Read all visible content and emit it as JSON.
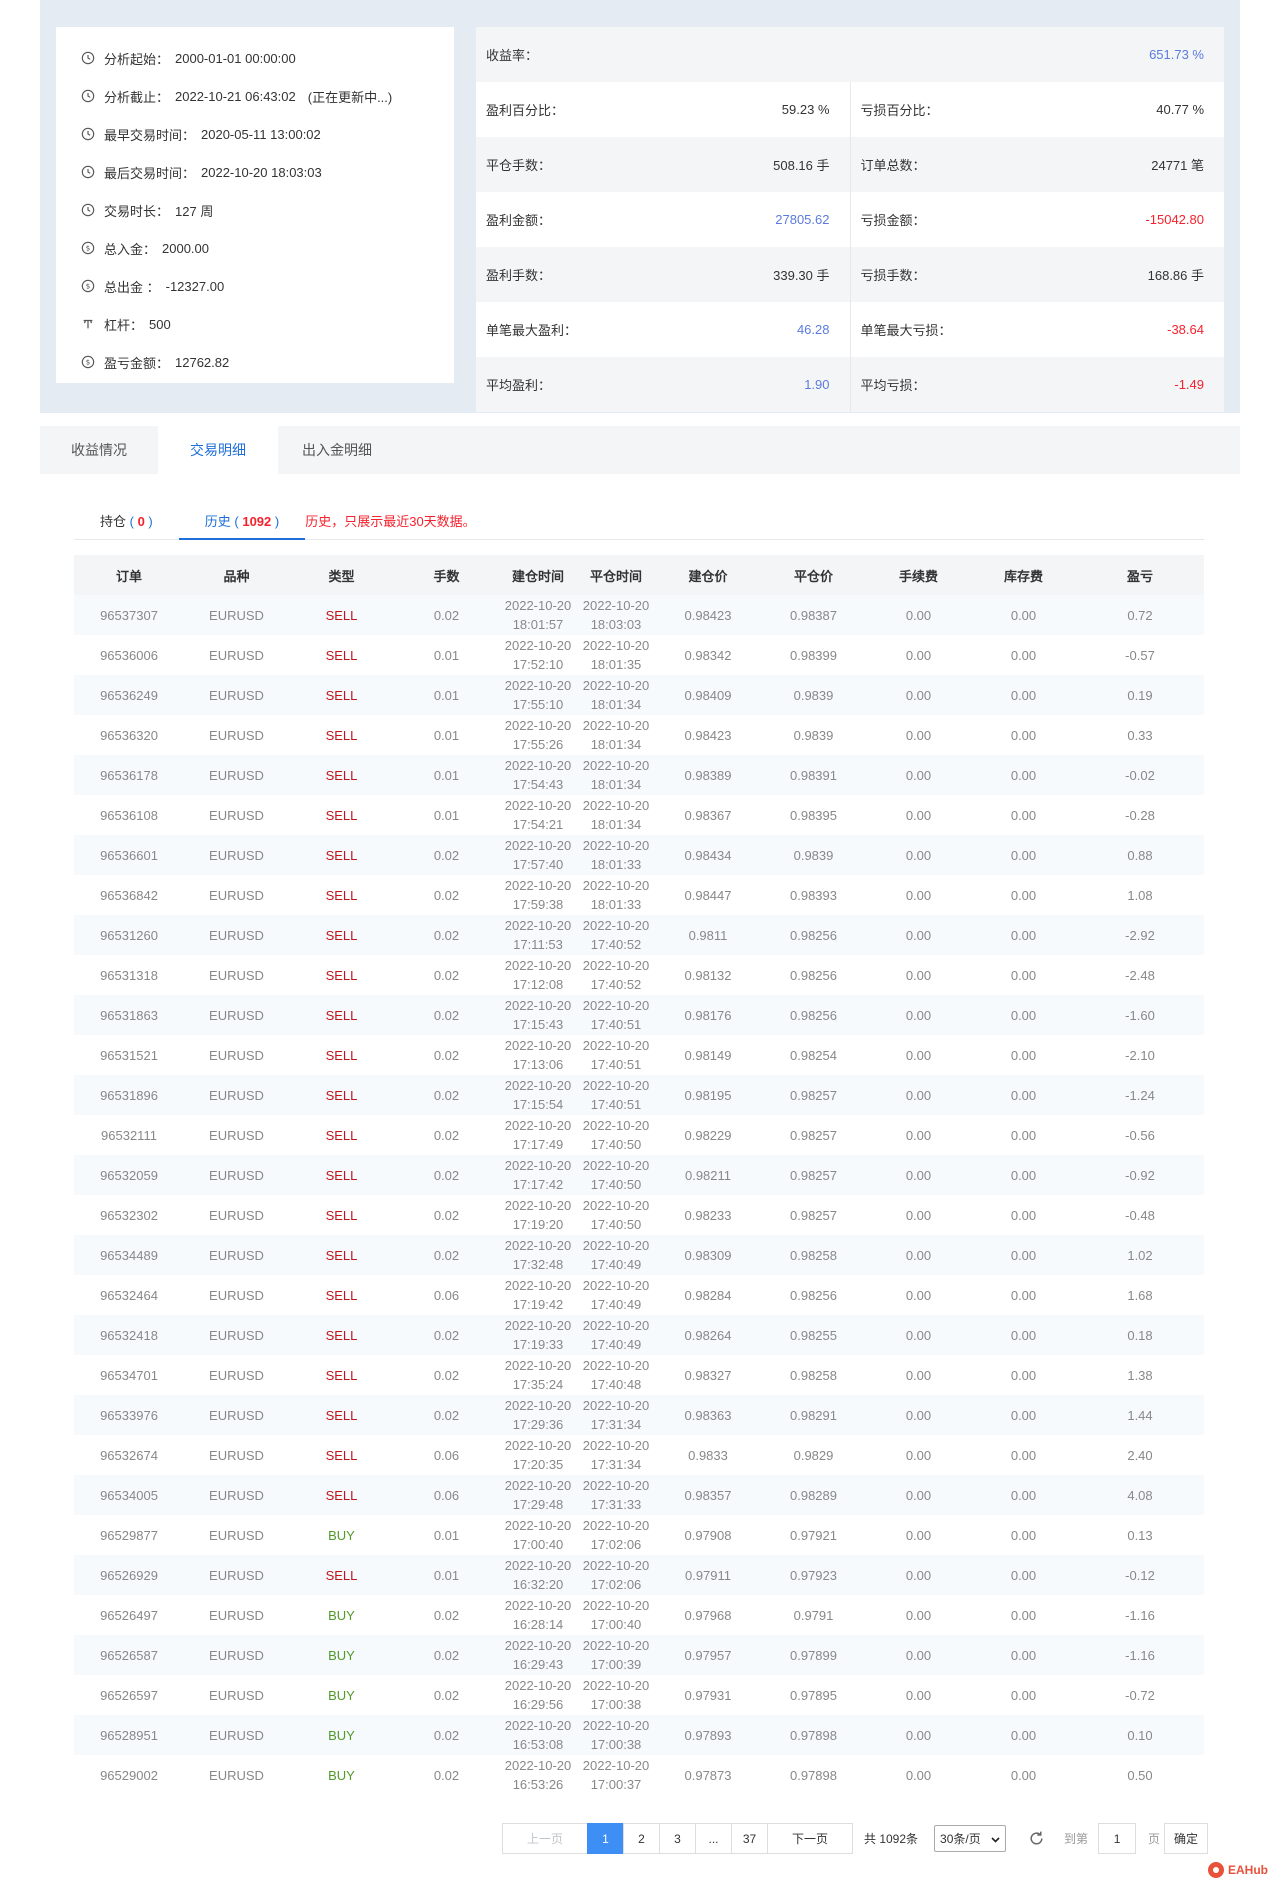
{
  "info": {
    "analysis_start_label": "分析起始：",
    "analysis_start": "2000-01-01 00:00:00",
    "analysis_end_label": "分析截止：",
    "analysis_end": "2022-10-21 06:43:02",
    "analysis_end_status": "(正在更新中...)",
    "earliest_trade_label": "最早交易时间：",
    "earliest_trade": "2020-05-11 13:00:02",
    "latest_trade_label": "最后交易时间：",
    "latest_trade": "2022-10-20 18:03:03",
    "duration_label": "交易时长：",
    "duration": "127 周",
    "deposit_label": "总入金：",
    "deposit": "2000.00",
    "withdrawal_label": "总出金 ：",
    "withdrawal": "-12327.00",
    "leverage_label": "杠杆：",
    "leverage": "500",
    "pnl_amount_label": "盈亏金额：",
    "pnl_amount": "12762.82"
  },
  "stats": {
    "return_rate_label": "收益率：",
    "return_rate": "651.73 %",
    "win_pct_label": "盈利百分比：",
    "win_pct": "59.23 %",
    "loss_pct_label": "亏损百分比：",
    "loss_pct": "40.77 %",
    "closed_lots_label": "平仓手数：",
    "closed_lots": "508.16 手",
    "order_total_label": "订单总数：",
    "order_total": "24771 笔",
    "profit_amount_label": "盈利金额：",
    "profit_amount": "27805.62",
    "loss_amount_label": "亏损金额：",
    "loss_amount": "-15042.80",
    "profit_lots_label": "盈利手数：",
    "profit_lots": "339.30 手",
    "loss_lots_label": "亏损手数：",
    "loss_lots": "168.86 手",
    "max_profit_label": "单笔最大盈利：",
    "max_profit": "46.28",
    "max_loss_label": "单笔最大亏损：",
    "max_loss": "-38.64",
    "avg_profit_label": "平均盈利：",
    "avg_profit": "1.90",
    "avg_loss_label": "平均亏损：",
    "avg_loss": "-1.49"
  },
  "main_tabs": {
    "tab1": "收益情况",
    "tab2": "交易明细",
    "tab3": "出入金明细"
  },
  "sub_tabs": {
    "open_label": "持仓",
    "open_count": "0",
    "history_label": "历史",
    "history_count": "1092",
    "note": "历史，只展示最近30天数据。"
  },
  "table": {
    "headers": [
      "订单",
      "品种",
      "类型",
      "手数",
      "建仓时间",
      "平仓时间",
      "建仓价",
      "平仓价",
      "手续费",
      "库存费",
      "盈亏"
    ],
    "rows": [
      [
        "96537307",
        "EURUSD",
        "SELL",
        "0.02",
        "2022-10-20",
        "18:01:57",
        "2022-10-20",
        "18:03:03",
        "0.98423",
        "0.98387",
        "0.00",
        "0.00",
        "0.72"
      ],
      [
        "96536006",
        "EURUSD",
        "SELL",
        "0.01",
        "2022-10-20",
        "17:52:10",
        "2022-10-20",
        "18:01:35",
        "0.98342",
        "0.98399",
        "0.00",
        "0.00",
        "-0.57"
      ],
      [
        "96536249",
        "EURUSD",
        "SELL",
        "0.01",
        "2022-10-20",
        "17:55:10",
        "2022-10-20",
        "18:01:34",
        "0.98409",
        "0.9839",
        "0.00",
        "0.00",
        "0.19"
      ],
      [
        "96536320",
        "EURUSD",
        "SELL",
        "0.01",
        "2022-10-20",
        "17:55:26",
        "2022-10-20",
        "18:01:34",
        "0.98423",
        "0.9839",
        "0.00",
        "0.00",
        "0.33"
      ],
      [
        "96536178",
        "EURUSD",
        "SELL",
        "0.01",
        "2022-10-20",
        "17:54:43",
        "2022-10-20",
        "18:01:34",
        "0.98389",
        "0.98391",
        "0.00",
        "0.00",
        "-0.02"
      ],
      [
        "96536108",
        "EURUSD",
        "SELL",
        "0.01",
        "2022-10-20",
        "17:54:21",
        "2022-10-20",
        "18:01:34",
        "0.98367",
        "0.98395",
        "0.00",
        "0.00",
        "-0.28"
      ],
      [
        "96536601",
        "EURUSD",
        "SELL",
        "0.02",
        "2022-10-20",
        "17:57:40",
        "2022-10-20",
        "18:01:33",
        "0.98434",
        "0.9839",
        "0.00",
        "0.00",
        "0.88"
      ],
      [
        "96536842",
        "EURUSD",
        "SELL",
        "0.02",
        "2022-10-20",
        "17:59:38",
        "2022-10-20",
        "18:01:33",
        "0.98447",
        "0.98393",
        "0.00",
        "0.00",
        "1.08"
      ],
      [
        "96531260",
        "EURUSD",
        "SELL",
        "0.02",
        "2022-10-20",
        "17:11:53",
        "2022-10-20",
        "17:40:52",
        "0.9811",
        "0.98256",
        "0.00",
        "0.00",
        "-2.92"
      ],
      [
        "96531318",
        "EURUSD",
        "SELL",
        "0.02",
        "2022-10-20",
        "17:12:08",
        "2022-10-20",
        "17:40:52",
        "0.98132",
        "0.98256",
        "0.00",
        "0.00",
        "-2.48"
      ],
      [
        "96531863",
        "EURUSD",
        "SELL",
        "0.02",
        "2022-10-20",
        "17:15:43",
        "2022-10-20",
        "17:40:51",
        "0.98176",
        "0.98256",
        "0.00",
        "0.00",
        "-1.60"
      ],
      [
        "96531521",
        "EURUSD",
        "SELL",
        "0.02",
        "2022-10-20",
        "17:13:06",
        "2022-10-20",
        "17:40:51",
        "0.98149",
        "0.98254",
        "0.00",
        "0.00",
        "-2.10"
      ],
      [
        "96531896",
        "EURUSD",
        "SELL",
        "0.02",
        "2022-10-20",
        "17:15:54",
        "2022-10-20",
        "17:40:51",
        "0.98195",
        "0.98257",
        "0.00",
        "0.00",
        "-1.24"
      ],
      [
        "96532111",
        "EURUSD",
        "SELL",
        "0.02",
        "2022-10-20",
        "17:17:49",
        "2022-10-20",
        "17:40:50",
        "0.98229",
        "0.98257",
        "0.00",
        "0.00",
        "-0.56"
      ],
      [
        "96532059",
        "EURUSD",
        "SELL",
        "0.02",
        "2022-10-20",
        "17:17:42",
        "2022-10-20",
        "17:40:50",
        "0.98211",
        "0.98257",
        "0.00",
        "0.00",
        "-0.92"
      ],
      [
        "96532302",
        "EURUSD",
        "SELL",
        "0.02",
        "2022-10-20",
        "17:19:20",
        "2022-10-20",
        "17:40:50",
        "0.98233",
        "0.98257",
        "0.00",
        "0.00",
        "-0.48"
      ],
      [
        "96534489",
        "EURUSD",
        "SELL",
        "0.02",
        "2022-10-20",
        "17:32:48",
        "2022-10-20",
        "17:40:49",
        "0.98309",
        "0.98258",
        "0.00",
        "0.00",
        "1.02"
      ],
      [
        "96532464",
        "EURUSD",
        "SELL",
        "0.06",
        "2022-10-20",
        "17:19:42",
        "2022-10-20",
        "17:40:49",
        "0.98284",
        "0.98256",
        "0.00",
        "0.00",
        "1.68"
      ],
      [
        "96532418",
        "EURUSD",
        "SELL",
        "0.02",
        "2022-10-20",
        "17:19:33",
        "2022-10-20",
        "17:40:49",
        "0.98264",
        "0.98255",
        "0.00",
        "0.00",
        "0.18"
      ],
      [
        "96534701",
        "EURUSD",
        "SELL",
        "0.02",
        "2022-10-20",
        "17:35:24",
        "2022-10-20",
        "17:40:48",
        "0.98327",
        "0.98258",
        "0.00",
        "0.00",
        "1.38"
      ],
      [
        "96533976",
        "EURUSD",
        "SELL",
        "0.02",
        "2022-10-20",
        "17:29:36",
        "2022-10-20",
        "17:31:34",
        "0.98363",
        "0.98291",
        "0.00",
        "0.00",
        "1.44"
      ],
      [
        "96532674",
        "EURUSD",
        "SELL",
        "0.06",
        "2022-10-20",
        "17:20:35",
        "2022-10-20",
        "17:31:34",
        "0.9833",
        "0.9829",
        "0.00",
        "0.00",
        "2.40"
      ],
      [
        "96534005",
        "EURUSD",
        "SELL",
        "0.06",
        "2022-10-20",
        "17:29:48",
        "2022-10-20",
        "17:31:33",
        "0.98357",
        "0.98289",
        "0.00",
        "0.00",
        "4.08"
      ],
      [
        "96529877",
        "EURUSD",
        "BUY",
        "0.01",
        "2022-10-20",
        "17:00:40",
        "2022-10-20",
        "17:02:06",
        "0.97908",
        "0.97921",
        "0.00",
        "0.00",
        "0.13"
      ],
      [
        "96526929",
        "EURUSD",
        "SELL",
        "0.01",
        "2022-10-20",
        "16:32:20",
        "2022-10-20",
        "17:02:06",
        "0.97911",
        "0.97923",
        "0.00",
        "0.00",
        "-0.12"
      ],
      [
        "96526497",
        "EURUSD",
        "BUY",
        "0.02",
        "2022-10-20",
        "16:28:14",
        "2022-10-20",
        "17:00:40",
        "0.97968",
        "0.9791",
        "0.00",
        "0.00",
        "-1.16"
      ],
      [
        "96526587",
        "EURUSD",
        "BUY",
        "0.02",
        "2022-10-20",
        "16:29:43",
        "2022-10-20",
        "17:00:39",
        "0.97957",
        "0.97899",
        "0.00",
        "0.00",
        "-1.16"
      ],
      [
        "96526597",
        "EURUSD",
        "BUY",
        "0.02",
        "2022-10-20",
        "16:29:56",
        "2022-10-20",
        "17:00:38",
        "0.97931",
        "0.97895",
        "0.00",
        "0.00",
        "-0.72"
      ],
      [
        "96528951",
        "EURUSD",
        "BUY",
        "0.02",
        "2022-10-20",
        "16:53:08",
        "2022-10-20",
        "17:00:38",
        "0.97893",
        "0.97898",
        "0.00",
        "0.00",
        "0.10"
      ],
      [
        "96529002",
        "EURUSD",
        "BUY",
        "0.02",
        "2022-10-20",
        "16:53:26",
        "2022-10-20",
        "17:00:37",
        "0.97873",
        "0.97898",
        "0.00",
        "0.00",
        "0.50"
      ]
    ]
  },
  "pagination": {
    "prev": "上一页",
    "pages": [
      "1",
      "2",
      "3",
      "...",
      "37"
    ],
    "next": "下一页",
    "total": "共 1092条",
    "page_size": "30条/页",
    "goto_label": "到第",
    "goto_value": "1",
    "page_suffix": "页",
    "confirm": "确定"
  },
  "brand": {
    "name": "EAHub"
  },
  "colors": {
    "accent": "#1e6fd9",
    "sell": "#c0151b",
    "buy": "#4f9a28",
    "loss": "#f5222d",
    "link_value": "#5b7bde",
    "page_active": "#3d8ef5"
  }
}
